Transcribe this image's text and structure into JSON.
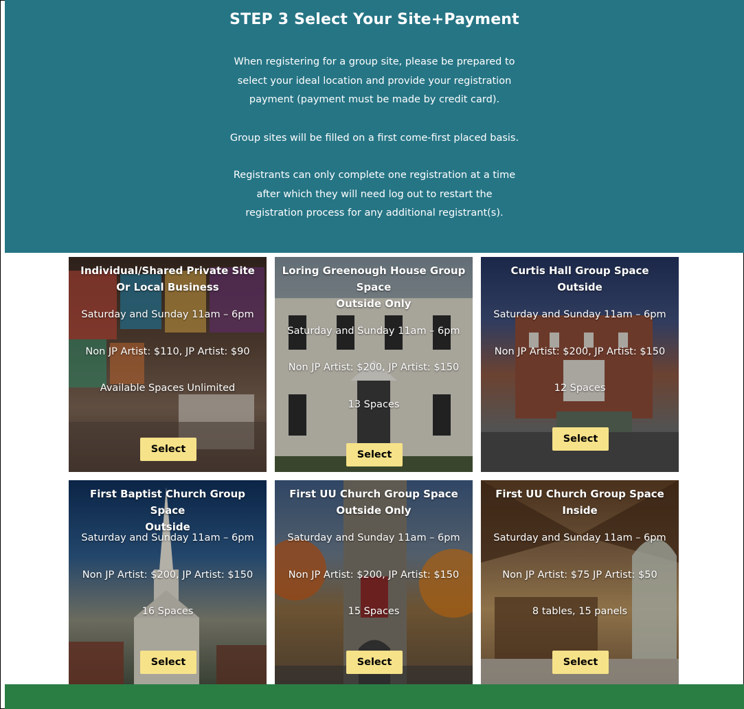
{
  "header": {
    "title": "STEP 3 Select Your Site+Payment",
    "paragraph1": "When registering for a group site, please be prepared to\nselect your ideal location and provide your registration\npayment (payment must be made by credit card).",
    "paragraph2": "Group sites will be filled on a first come-first placed basis.",
    "paragraph3": "Registrants can only complete one registration at a time\nafter which they will need log out to restart the\nregistration process for any additional registrant(s)."
  },
  "cards": [
    {
      "title": "Individual/Shared Private Site\nOr Local Business",
      "hours": "Saturday and Sunday 11am – 6pm",
      "price": "Non JP Artist: $110, JP Artist: $90",
      "spaces": "Available Spaces Unlimited",
      "button": "Select"
    },
    {
      "title": "Loring Greenough House Group\nSpace\nOutside Only",
      "hours": "Saturday and Sunday 11am – 6pm",
      "price": "Non JP Artist: $200, JP Artist: $150",
      "spaces": "13 Spaces",
      "button": "Select"
    },
    {
      "title": "Curtis Hall Group Space\nOutside",
      "hours": "Saturday and Sunday 11am – 6pm",
      "price": "Non JP Artist: $200, JP Artist: $150",
      "spaces": "12 Spaces",
      "button": "Select"
    },
    {
      "title": "First Baptist Church Group Space\nOutside",
      "hours": "Saturday and Sunday 11am – 6pm",
      "price": "Non JP Artist: $200, JP Artist: $150",
      "spaces": "16 Spaces",
      "button": "Select"
    },
    {
      "title": "First UU Church Group Space\nOutside Only",
      "hours": "Saturday and Sunday 11am – 6pm",
      "price": "Non JP Artist: $200, JP Artist: $150",
      "spaces": "15 Spaces",
      "button": "Select"
    },
    {
      "title": "First UU Church Group Space\nInside",
      "hours": "Saturday and Sunday 11am – 6pm",
      "price": "Non JP Artist: $75 JP Artist: $50",
      "spaces": "8 tables, 15 panels",
      "button": "Select"
    }
  ],
  "colors": {
    "header_bg": "#267585",
    "footer_bg": "#2a7e44",
    "button_bg": "#f6e289"
  }
}
